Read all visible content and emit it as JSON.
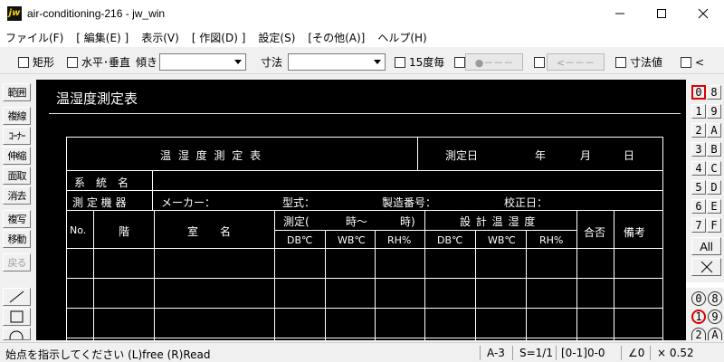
{
  "window": {
    "title": "air-conditioning-216 - jw_win",
    "app_icon_text": "jw"
  },
  "menu": [
    "ファイル(F)",
    "[ 編集(E) ]",
    "表示(V)",
    "[ 作図(D) ]",
    "設定(S)",
    "[その他(A)]",
    "ヘルプ(H)"
  ],
  "toolbar": {
    "rect_label": "矩形",
    "hv_label": "水平･垂直",
    "tilt_label": "傾き",
    "tilt_value": "",
    "dim_label": "寸法",
    "dim_value": "",
    "deg15_label": "15度毎",
    "point_btn": "●－－－",
    "arrow_btn": "<－－－",
    "dimval_label": "寸法値",
    "lt_label": "<"
  },
  "left_tools": [
    "範囲",
    "複線",
    "ｺｰﾅｰ",
    "伸縮",
    "面取",
    "消去",
    "複写",
    "移動",
    "戻る"
  ],
  "drawing": {
    "heading": "温湿度測定表",
    "form_title": "温 湿 度 測 定 表",
    "date_label": "測定日",
    "year": "年",
    "month": "月",
    "day": "日",
    "system_label": "系　統　名",
    "equipment_label": "測 定 機 器",
    "maker_label": "メーカー：",
    "model_label": "型式：",
    "serial_label": "製造番号：",
    "calib_label": "校正日：",
    "col_no": "No.",
    "col_floor": "階",
    "col_room": "室　　名",
    "measure_label": "測定(",
    "time_from": "時～",
    "time_to": "時)",
    "design_label": "設 計 温 湿 度",
    "pass_label": "合否",
    "remarks_label": "備考",
    "sub_db": "DB℃",
    "sub_wb": "WB℃",
    "sub_rh": "RH%"
  },
  "layers": {
    "left": [
      "0",
      "1",
      "2",
      "3",
      "4",
      "5",
      "6",
      "7"
    ],
    "right": [
      "8",
      "9",
      "A",
      "B",
      "C",
      "D",
      "E",
      "F"
    ],
    "all_label": "All",
    "active_layer": "0",
    "groups_left": [
      "0",
      "1",
      "2"
    ],
    "groups_right": [
      "8",
      "9",
      "A"
    ],
    "active_group": "1"
  },
  "status": {
    "message": "始点を指示してください (L)free (R)Read",
    "paper": "A-3",
    "scale": "S=1/1",
    "layer_info": "[0-1]0-0",
    "angle": "∠0",
    "zoom": "× 0.52"
  }
}
